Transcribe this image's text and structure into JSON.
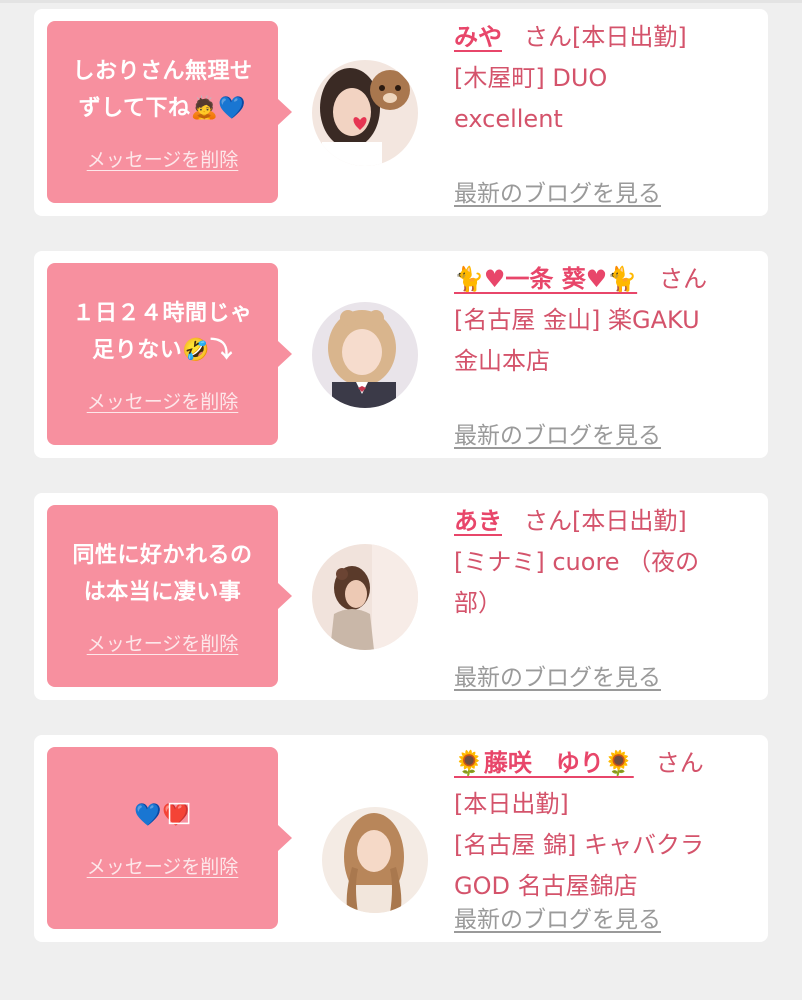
{
  "delete_label": "メッセージを削除",
  "blog_label": "最新のブログを見る",
  "entries": [
    {
      "message": "しおりさん無理せ\nずして下ね🙇💙",
      "name": "みや",
      "honorific": "さん[本日出勤]",
      "shop_lines": [
        "[木屋町] DUO",
        "excellent"
      ]
    },
    {
      "message": "１日２４時間じゃ\n足りない🤣⤵",
      "name": "🐈♥一条 葵♥🐈",
      "honorific": "さん",
      "shop_lines": [
        "[名古屋 金山] 楽GAKU",
        "金山本店"
      ]
    },
    {
      "message": "同性に好かれるの\nは本当に凄い事",
      "name": "あき",
      "honorific": "さん[本日出勤]",
      "shop_lines": [
        "[ミナミ] cuore （夜の",
        "部）"
      ]
    },
    {
      "message": "💙❤️⃞",
      "name": "🌻藤咲　ゆり🌻",
      "honorific": "さん",
      "shop_lines": [
        "[本日出勤]",
        "[名古屋 錦] キャバクラ",
        "GOD 名古屋錦店"
      ]
    }
  ]
}
